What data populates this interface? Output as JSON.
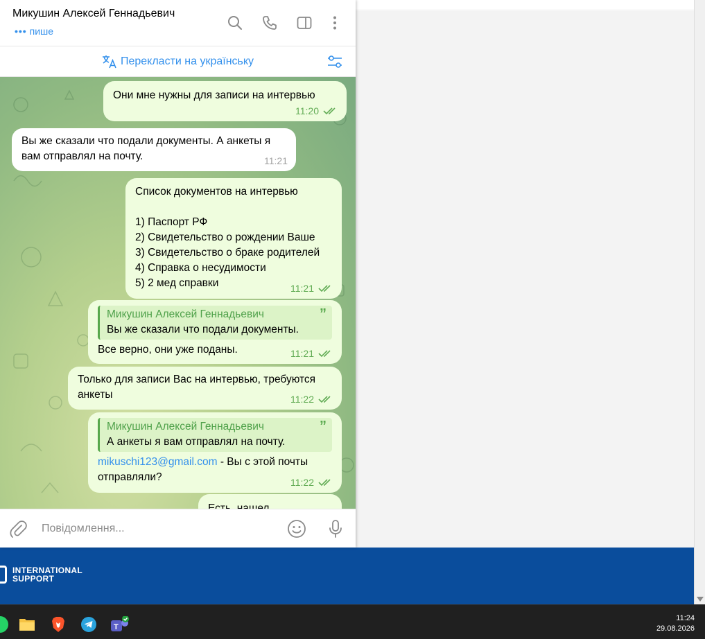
{
  "chat": {
    "title": "Микушин Алексей Геннадьевич",
    "status_dots": "•••",
    "status_text": "пише"
  },
  "translate": {
    "label": "Перекласти на українську"
  },
  "messages": {
    "m1": {
      "text": "Они мне нужны для записи на интервью",
      "time": "11:20"
    },
    "m2": {
      "line1": "Вы же сказали что подали документы. А анкеты я",
      "line2": "вам отправлял на почту.",
      "time": "11:21"
    },
    "m3": {
      "lines": [
        "Список документов на интервью",
        "",
        "1) Паспорт РФ",
        "2) Свидетельство о рождении Ваше",
        "3) Свидетельство о браке родителей",
        "4) Справка о несудимости",
        "5) 2 мед справки"
      ],
      "time": "11:21"
    },
    "m4": {
      "reply_author": "Микушин Алексей Геннадьевич",
      "reply_text": "Вы же сказали что подали документы.",
      "text": "Все верно, они уже поданы.",
      "time": "11:21"
    },
    "m5": {
      "line1": "Только для записи Вас на интервью, требуются",
      "line2": "анкеты",
      "time": "11:22"
    },
    "m6": {
      "reply_author": "Микушин Алексей Геннадьевич",
      "reply_text": "А анкеты я вам отправлял на почту.",
      "link": "mikuschi123@gmail.com",
      "text_after": " - Вы с этой почты",
      "line2": "отправляли?",
      "time": "11:22"
    },
    "m7": {
      "text": "Есть, нашел"
    }
  },
  "composer": {
    "placeholder": "Повідомлення..."
  },
  "banner": {
    "line1": "INTERNATIONAL",
    "line2": "SUPPORT"
  },
  "taskbar": {
    "time": "11:24",
    "date": "29.08.2026"
  },
  "colors": {
    "accent": "#3390ec",
    "out_bubble": "#effdde",
    "check_green": "#62ac55",
    "banner_blue": "#0a4d9c"
  }
}
